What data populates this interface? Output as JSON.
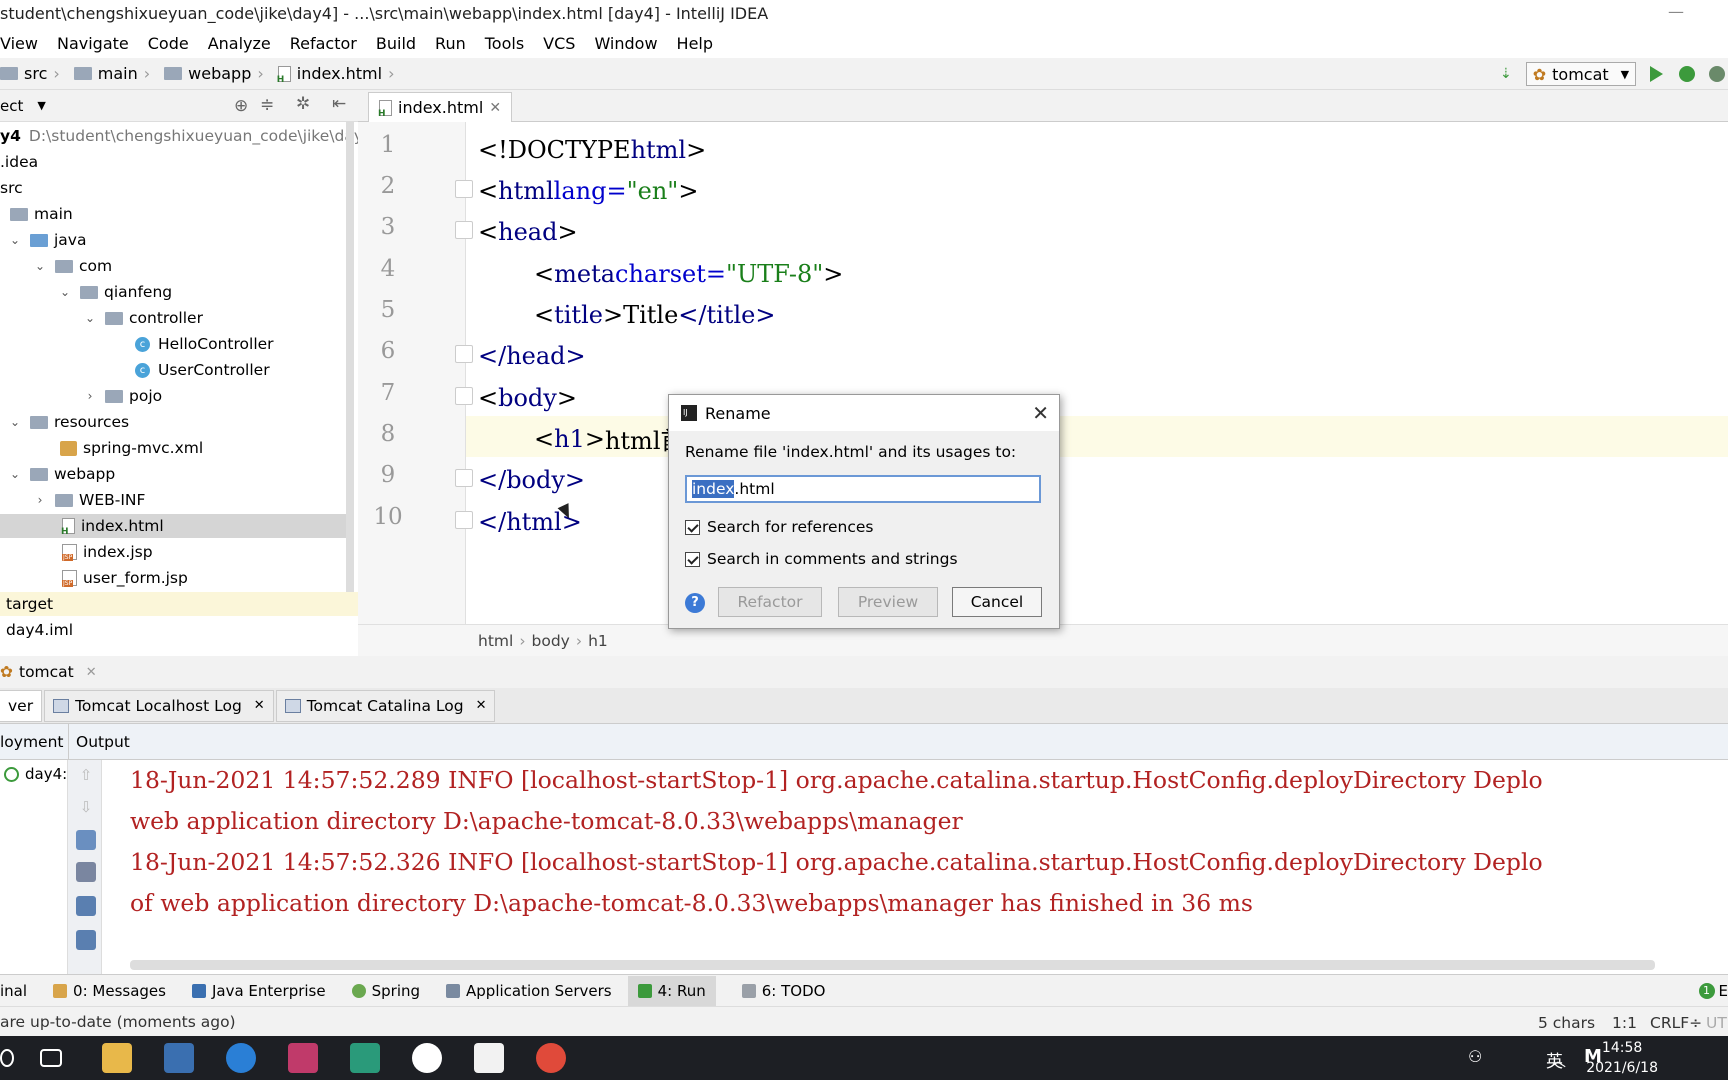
{
  "window": {
    "title": "student\\chengshixueyuan_code\\jike\\day4] - ...\\src\\main\\webapp\\index.html [day4] - IntelliJ IDEA"
  },
  "menu": [
    "View",
    "Navigate",
    "Code",
    "Analyze",
    "Refactor",
    "Build",
    "Run",
    "Tools",
    "VCS",
    "Window",
    "Help"
  ],
  "nav": {
    "crumbs": [
      "src",
      "main",
      "webapp",
      "index.html"
    ],
    "run_config": "tomcat"
  },
  "project": {
    "header": "ect",
    "root_label": "y4",
    "root_path": "D:\\student\\chengshixueyuan_code\\jike\\day4",
    "items": [
      ".idea",
      "src",
      "main",
      "java",
      "com",
      "qianfeng",
      "controller",
      "HelloController",
      "UserController",
      "pojo",
      "resources",
      "spring-mvc.xml",
      "webapp",
      "WEB-INF",
      "index.html",
      "index.jsp",
      "user_form.jsp",
      "target",
      "day4.iml"
    ]
  },
  "editor": {
    "tab": "index.html",
    "line_numbers": [
      "1",
      "2",
      "3",
      "4",
      "5",
      "6",
      "7",
      "8",
      "9",
      "10"
    ],
    "lines": {
      "l1_open": "<!DOCTYPE ",
      "l1_tag": "html",
      "l1_close": ">",
      "l2_open": "<",
      "l2_tag": "html ",
      "l2_attr": "lang=",
      "l2_val": "\"en\"",
      "l2_close": ">",
      "l3": "head",
      "l4_tag": "meta ",
      "l4_attr": "charset=",
      "l4_val": "\"UTF-8\"",
      "l5_tag": "title",
      "l5_text": "Title",
      "l5_end": "</title>",
      "l6": "</head>",
      "l7": "body",
      "l8_tag": "h1",
      "l8_text": "html首",
      "l9": "</body>",
      "l10": "</html>"
    },
    "breadcrumbs": [
      "html",
      "body",
      "h1"
    ]
  },
  "dialog": {
    "title": "Rename",
    "prompt": "Rename file 'index.html' and its usages to:",
    "input_selected": "index",
    "input_rest": ".html",
    "check1": "Search for references",
    "check2": "Search in comments and strings",
    "btn_refactor": "Refactor",
    "btn_preview": "Preview",
    "btn_cancel": "Cancel",
    "help": "?"
  },
  "run": {
    "title": "tomcat",
    "tabs": [
      "ver",
      "Tomcat Localhost Log",
      "Tomcat Catalina Log"
    ],
    "col_deploy": "loyment",
    "col_output": "Output",
    "deploy_item": "day4:",
    "log": [
      "18-Jun-2021 14:57:52.289 INFO [localhost-startStop-1] org.apache.catalina.startup.HostConfig.deployDirectory Deplo",
      " web application directory D:\\apache-tomcat-8.0.33\\webapps\\manager",
      "18-Jun-2021 14:57:52.326 INFO [localhost-startStop-1] org.apache.catalina.startup.HostConfig.deployDirectory Deplo",
      "  of web application directory D:\\apache-tomcat-8.0.33\\webapps\\manager has finished in 36 ms"
    ]
  },
  "tool_windows": [
    "inal",
    "0: Messages",
    "Java Enterprise",
    "Spring",
    "Application Servers",
    "4: Run",
    "6: TODO"
  ],
  "status": {
    "message": "are up-to-date (moments ago)",
    "chars": "5 chars",
    "pos": "1:1",
    "line_sep": "CRLF÷",
    "enc": "UT",
    "event_count": "1",
    "event_label": "E"
  },
  "taskbar": {
    "time": "14:58",
    "date": "2021/6/18",
    "ime": "英",
    "ime2": "M"
  }
}
